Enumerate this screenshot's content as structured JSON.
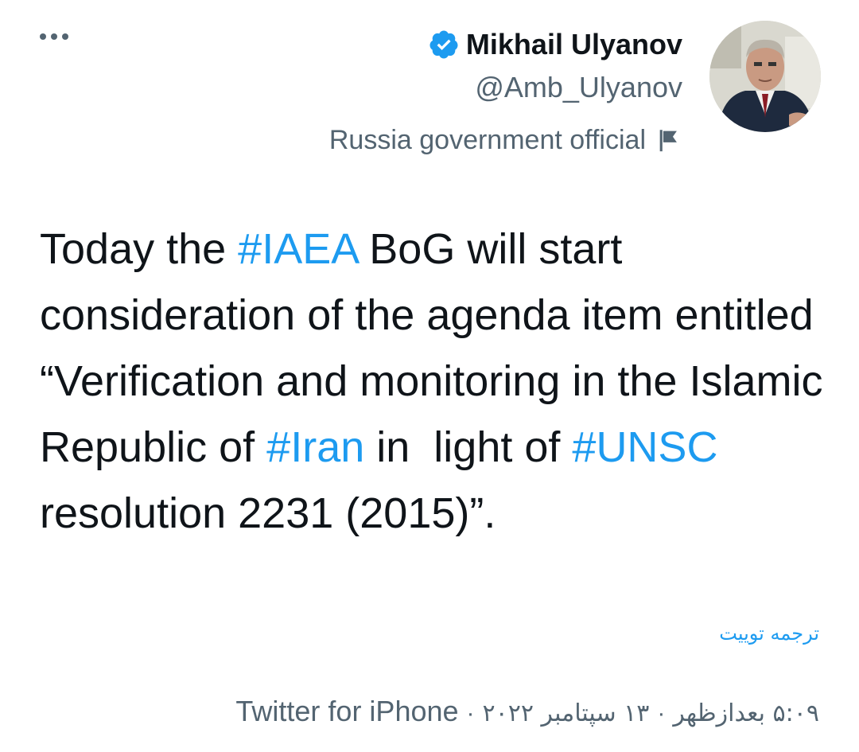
{
  "author": {
    "name": "Mikhail Ulyanov",
    "handle": "@Amb_Ulyanov",
    "label": "Russia government official",
    "verified_icon": "verified-badge-icon",
    "label_icon": "flag-icon"
  },
  "tweet": {
    "segments": [
      {
        "text": "Today the ",
        "type": "text"
      },
      {
        "text": "#IAEA",
        "type": "hashtag"
      },
      {
        "text": " BoG will start consideration of the agenda item entitled “Verification and monitoring in the Islamic Republic of ",
        "type": "text"
      },
      {
        "text": "#Iran",
        "type": "hashtag"
      },
      {
        "text": " in  light of ",
        "type": "text"
      },
      {
        "text": "#UNSC",
        "type": "hashtag"
      },
      {
        "text": " resolution 2231 (2015)”.",
        "type": "text"
      }
    ],
    "translate_label": "ترجمه توییت"
  },
  "meta": {
    "time": "۵:۰۹ بعدازظهر",
    "date": "۱۳ سپتامبر ۲۰۲۲",
    "source": "Twitter for iPhone",
    "separator": "·"
  },
  "colors": {
    "text": "#0f1419",
    "secondary": "#536471",
    "link": "#1d9bf0"
  }
}
